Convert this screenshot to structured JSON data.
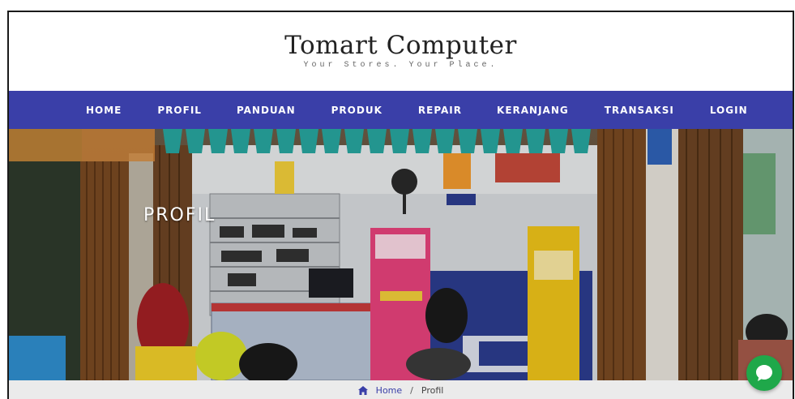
{
  "header": {
    "title": "Tomart Computer",
    "tagline": "Your Stores. Your Place."
  },
  "nav": {
    "items": [
      {
        "label": "HOME"
      },
      {
        "label": "PROFIL"
      },
      {
        "label": "PANDUAN"
      },
      {
        "label": "PRODUK"
      },
      {
        "label": "REPAIR"
      },
      {
        "label": "KERANJANG"
      },
      {
        "label": "TRANSAKSI"
      },
      {
        "label": "LOGIN"
      }
    ]
  },
  "hero": {
    "title": "PROFIL"
  },
  "breadcrumb": {
    "home": "Home",
    "separator": "/",
    "current": "Profil"
  },
  "colors": {
    "nav_bg": "#3a3fa8",
    "chat_button": "#1fa84a",
    "breadcrumb_link": "#3a3fa8"
  },
  "icons": {
    "home": "home-icon",
    "chat": "chat-icon"
  }
}
